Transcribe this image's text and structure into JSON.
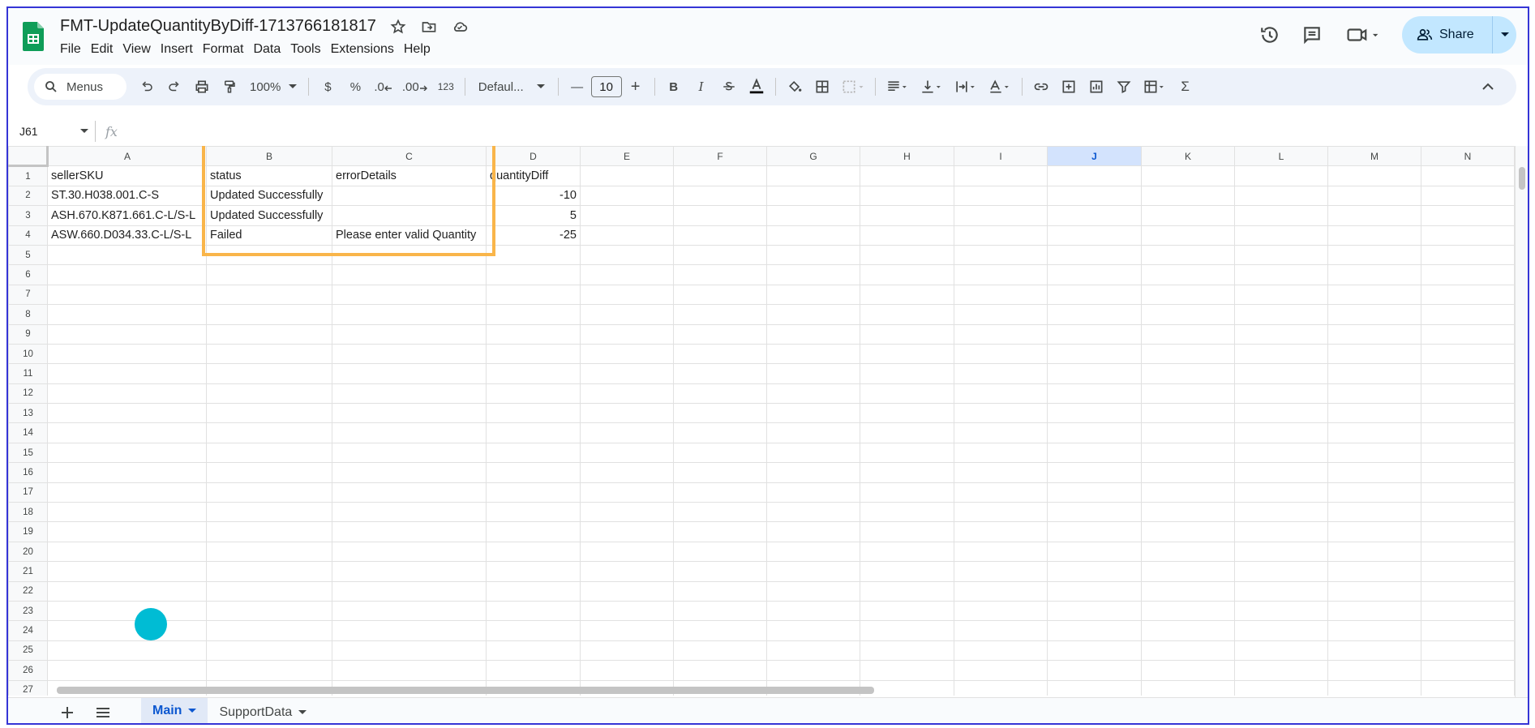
{
  "doc": {
    "title": "FMT-UpdateQuantityByDiff-1713766181817"
  },
  "menu": [
    "File",
    "Edit",
    "View",
    "Insert",
    "Format",
    "Data",
    "Tools",
    "Extensions",
    "Help"
  ],
  "share": {
    "label": "Share"
  },
  "toolbar": {
    "menus_label": "Menus",
    "zoom": "100%",
    "currency": "$",
    "percent": "%",
    "dec_decrease": ".0",
    "dec_increase": ".00",
    "number_format": "123",
    "font": "Defaul...",
    "font_size": "10",
    "minus": "—",
    "plus": "+",
    "bold": "B",
    "italic": "I",
    "sum": "Σ"
  },
  "formula_bar": {
    "cell_ref": "J61",
    "fx": "fx"
  },
  "columns": [
    "A",
    "B",
    "C",
    "D",
    "E",
    "F",
    "G",
    "H",
    "I",
    "J",
    "K",
    "L",
    "M",
    "N"
  ],
  "selected_column": "J",
  "rows": [
    [
      "sellerSKU",
      "status",
      "errorDetails",
      "quantityDiff"
    ],
    [
      "ST.30.H038.001.C-S",
      "Updated Successfully",
      "",
      "-10"
    ],
    [
      "ASH.670.K871.661.C-L/S-L",
      "Updated Successfully",
      "",
      "5"
    ],
    [
      "ASW.660.D034.33.C-L/S-L",
      "Failed",
      "Please enter valid Quantity",
      "-25"
    ]
  ],
  "row_numbers": [
    "1",
    "2",
    "3",
    "4",
    "5",
    "6",
    "7",
    "8",
    "9",
    "10",
    "11",
    "12",
    "13",
    "14",
    "15",
    "16",
    "17",
    "18",
    "19",
    "20",
    "21",
    "22",
    "23",
    "24",
    "25",
    "26",
    "27"
  ],
  "sheets": [
    {
      "label": "Main",
      "active": true
    },
    {
      "label": "SupportData",
      "active": false
    }
  ],
  "colors": {
    "highlight": "#f9b54a",
    "cursor": "#00bcd4",
    "share_bg": "#c2e7ff",
    "active_tab": "#0b57d0"
  }
}
